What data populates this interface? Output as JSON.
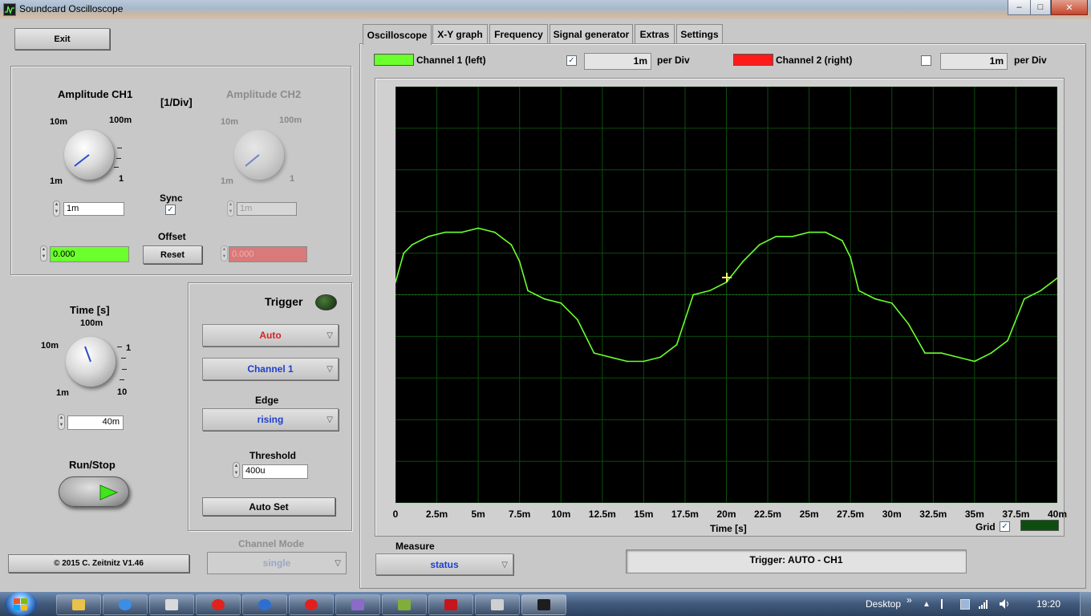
{
  "window": {
    "title": "Soundcard Oscilloscope",
    "minimize": "–",
    "maximize": "□",
    "close": "✕"
  },
  "left": {
    "exit_label": "Exit",
    "amp_ch1": {
      "title": "Amplitude CH1",
      "marks": [
        "10m",
        "100m",
        "1m",
        "1"
      ],
      "value": "1m"
    },
    "unit_label": "[1/Div]",
    "amp_ch2": {
      "title": "Amplitude CH2",
      "marks": [
        "10m",
        "100m",
        "1m",
        "1"
      ],
      "value": "1m"
    },
    "sync_label": "Sync",
    "offset_label": "Offset",
    "offset_ch1_value": "0.000",
    "offset_ch2_value": "0.000",
    "reset_label": "Reset",
    "time": {
      "title": "Time [s]",
      "marks": [
        "100m",
        "10m",
        "1",
        "1m",
        "10"
      ],
      "value": "40m"
    },
    "run_stop_label": "Run/Stop",
    "copyright": "© 2015  C. Zeitnitz V1.46",
    "channel_mode_label": "Channel Mode",
    "channel_mode_value": "single"
  },
  "trigger": {
    "title": "Trigger",
    "mode": "Auto",
    "channel": "Channel 1",
    "edge_label": "Edge",
    "edge_value": "rising",
    "threshold_label": "Threshold",
    "threshold_value": "400u",
    "auto_set_label": "Auto Set"
  },
  "tabs": [
    "Oscilloscope",
    "X-Y graph",
    "Frequency",
    "Signal generator",
    "Extras",
    "Settings"
  ],
  "channels": {
    "ch1_label": "Channel 1 (left)",
    "ch1_color": "#6bff2e",
    "ch1_per_div": "1m",
    "ch2_label": "Channel 2 (right)",
    "ch2_color": "#ff1a1a",
    "ch2_per_div": "1m",
    "per_div_label": "per Div"
  },
  "plot": {
    "x_ticks": [
      "0",
      "2.5m",
      "5m",
      "7.5m",
      "10m",
      "12.5m",
      "15m",
      "17.5m",
      "20m",
      "22.5m",
      "25m",
      "27.5m",
      "30m",
      "32.5m",
      "35m",
      "37.5m",
      "40m"
    ],
    "xlabel": "Time [s]",
    "grid_label": "Grid",
    "grid_color": "#0d4d0d"
  },
  "measure": {
    "label": "Measure",
    "value": "status"
  },
  "status_text": "Trigger: AUTO - CH1",
  "taskbar": {
    "desktop_label": "Desktop",
    "chevron": "»",
    "clock": "19:20"
  },
  "chart_data": {
    "type": "line",
    "xlabel": "Time [s]",
    "xlim": [
      0,
      0.04
    ],
    "ylim": [
      -5,
      5
    ],
    "grid": true,
    "x": [
      0,
      0.0005,
      0.001,
      0.002,
      0.003,
      0.004,
      0.005,
      0.006,
      0.007,
      0.0075,
      0.008,
      0.009,
      0.01,
      0.011,
      0.012,
      0.013,
      0.014,
      0.015,
      0.016,
      0.017,
      0.018,
      0.019,
      0.02,
      0.021,
      0.022,
      0.023,
      0.024,
      0.025,
      0.026,
      0.027,
      0.0275,
      0.028,
      0.029,
      0.03,
      0.031,
      0.032,
      0.033,
      0.034,
      0.035,
      0.036,
      0.037,
      0.038,
      0.039,
      0.04
    ],
    "series": [
      {
        "values": [
          0.3,
          1.0,
          1.2,
          1.4,
          1.5,
          1.5,
          1.6,
          1.5,
          1.2,
          0.8,
          0.1,
          -0.1,
          -0.2,
          -0.6,
          -1.4,
          -1.5,
          -1.6,
          -1.6,
          -1.5,
          -1.2,
          0.0,
          0.1,
          0.3,
          0.8,
          1.2,
          1.4,
          1.4,
          1.5,
          1.5,
          1.3,
          0.9,
          0.1,
          -0.1,
          -0.2,
          -0.7,
          -1.4,
          -1.4,
          -1.5,
          -1.6,
          -1.4,
          -1.1,
          -0.1,
          0.1,
          0.4
        ]
      }
    ]
  }
}
